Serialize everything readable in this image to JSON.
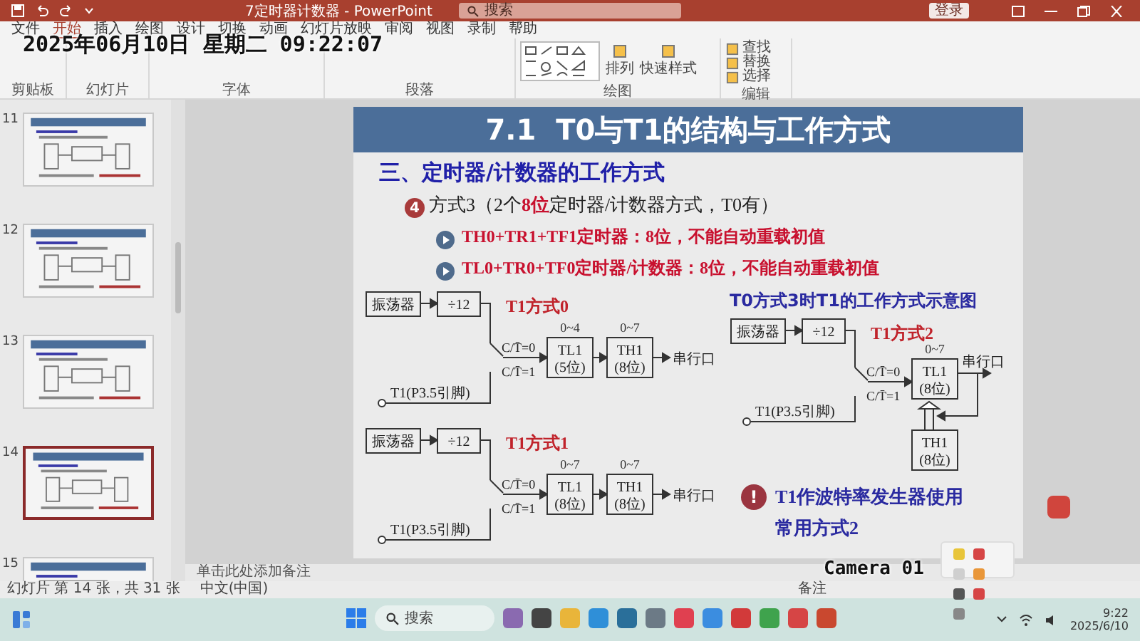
{
  "window": {
    "title": "7定时器计数器 - PowerPoint",
    "search": {
      "placeholder": "搜索"
    },
    "sign_in": "登录"
  },
  "overlay": {
    "timestamp": "2025年06月10日 星期二 09:22:07",
    "camera": "Camera 01"
  },
  "ribbon": {
    "tabs": [
      {
        "label": "文件",
        "selected": false
      },
      {
        "label": "开始",
        "selected": true
      },
      {
        "label": "插入",
        "selected": false
      },
      {
        "label": "绘图",
        "selected": false
      },
      {
        "label": "设计",
        "selected": false
      },
      {
        "label": "切换",
        "selected": false
      },
      {
        "label": "动画",
        "selected": false
      },
      {
        "label": "幻灯片放映",
        "selected": false
      },
      {
        "label": "审阅",
        "selected": false
      },
      {
        "label": "视图",
        "selected": false
      },
      {
        "label": "录制",
        "selected": false
      },
      {
        "label": "帮助",
        "selected": false
      }
    ],
    "groups": [
      {
        "label": "剪贴板"
      },
      {
        "label": "幻灯片"
      },
      {
        "label": "字体"
      },
      {
        "label": "段落"
      },
      {
        "label": "绘图",
        "buttons": [
          "排列",
          "快速样式"
        ]
      },
      {
        "label": "编辑",
        "buttons": [
          "查找",
          "替换",
          "选择"
        ]
      }
    ]
  },
  "slides_pane": {
    "thumbnails": [
      {
        "number": "11",
        "selected": false
      },
      {
        "number": "12",
        "selected": false
      },
      {
        "number": "13",
        "selected": false
      },
      {
        "number": "14",
        "selected": true
      },
      {
        "number": "15",
        "selected": false
      }
    ]
  },
  "slide": {
    "title": "7.1  T0与T1的结构与工作方式",
    "heading": "三、定时器/计数器的工作方式",
    "item": {
      "badge": "4",
      "text": "方式3（2个**8位**定时器/计数器方式，T0有）"
    },
    "bullets": [
      "TH0+TR1+TF1定时器：8位，不能自动重载初值",
      "TL0+TR0+TF0定时器/计数器：8位，不能自动重载初值"
    ],
    "diagrams": [
      {
        "kind": "cascade",
        "title": "T1方式0",
        "oscillator": "振荡器",
        "divider": "÷12",
        "switch_labels": [
          "C/T̄=0",
          "C/T̄=1"
        ],
        "pin": "T1(P3.5引脚)",
        "registers": [
          {
            "range": "0~4",
            "name": "TL1",
            "bits": "(5位)"
          },
          {
            "range": "0~7",
            "name": "TH1",
            "bits": "(8位)"
          }
        ],
        "output": "串行口"
      },
      {
        "kind": "cascade",
        "title": "T1方式1",
        "oscillator": "振荡器",
        "divider": "÷12",
        "switch_labels": [
          "C/T̄=0",
          "C/T̄=1"
        ],
        "pin": "T1(P3.5引脚)",
        "registers": [
          {
            "range": "0~7",
            "name": "TL1",
            "bits": "(8位)"
          },
          {
            "range": "0~7",
            "name": "TH1",
            "bits": "(8位)"
          }
        ],
        "output": "串行口"
      },
      {
        "kind": "reload",
        "caption": "T0方式3时T1的工作方式示意图",
        "title": "T1方式2",
        "oscillator": "振荡器",
        "divider": "÷12",
        "switch_labels": [
          "C/T̄=0",
          "C/T̄=1"
        ],
        "pin": "T1(P3.5引脚)",
        "registers": [
          {
            "range": "0~7",
            "name": "TL1",
            "bits": "(8位)"
          },
          {
            "name": "TH1",
            "bits": "(8位)"
          }
        ],
        "output": "串行口"
      }
    ],
    "note": {
      "badge": "!",
      "lines": [
        "T1作波特率发生器使用",
        "常用方式2"
      ]
    }
  },
  "notes": {
    "placeholder": "单击此处添加备注"
  },
  "status_bar": {
    "slide_counter": "幻灯片 第 14 张，共 31 张",
    "language": "中文(中国)",
    "notes_button": "备注"
  },
  "taskbar": {
    "search": {
      "placeholder": "搜索"
    },
    "time": "9:22",
    "date": "2025/6/10"
  }
}
